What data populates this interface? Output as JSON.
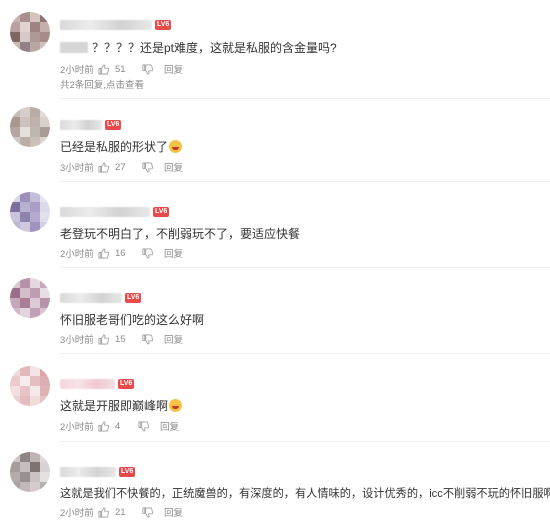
{
  "comments": [
    {
      "text": "？？？？还是pt难度，这就是私服的含金量吗?",
      "time": "2小时前",
      "likes": "51",
      "reply_label": "回复",
      "level": "LV6",
      "more_replies": {
        "count_text": "共2条回复,",
        "view_link": "点击查看"
      },
      "avatar_colors": [
        "#c9b3b0",
        "#a88e8c",
        "#d4c4c1",
        "#8f7673",
        "#b9a19f",
        "#e0d2cf",
        "#9d8381",
        "#c3aeab",
        "#7e6663",
        "#d8c9c6",
        "#b09896",
        "#a58b89",
        "#cdbbb8",
        "#938087",
        "#baa6a3",
        "#d1c1be"
      ]
    },
    {
      "text": "已经是私服的形状了",
      "time": "3小时前",
      "likes": "27",
      "reply_label": "回复",
      "level": "LV6",
      "avatar_colors": [
        "#c7bcb8",
        "#d6ccc9",
        "#b8aca8",
        "#e2dad7",
        "#a8998f",
        "#cdc2be",
        "#bfb2ad",
        "#d9d0cc",
        "#b3a59f",
        "#e6e0dd",
        "#c1b5b0",
        "#a99b95",
        "#d2c8c4",
        "#bcaea8",
        "#cbbfba",
        "#dcd3cf"
      ]
    },
    {
      "text": "老登玩不明白了，不削弱玩不了，要适应快餐",
      "time": "2小时前",
      "likes": "16",
      "reply_label": "回复",
      "level": "LV6",
      "avatar_colors": [
        "#d8d6e6",
        "#9c8fb8",
        "#c4bfd9",
        "#e6e4ef",
        "#7d6f9c",
        "#b8b1d0",
        "#a99fc4",
        "#dcd9e8",
        "#c9c3dc",
        "#8f82ad",
        "#b3abcd",
        "#e1dfec",
        "#bdb6d4",
        "#cfcae0",
        "#a094bf",
        "#d3cfe3"
      ]
    },
    {
      "text": "怀旧服老哥们吃的这么好啊",
      "time": "3小时前",
      "likes": "15",
      "reply_label": "回复",
      "level": "LV6",
      "avatar_colors": [
        "#d9c9d3",
        "#b691a8",
        "#e4d7df",
        "#c9a8bc",
        "#9a6d88",
        "#d3bdc9",
        "#bf9db1",
        "#e8dde4",
        "#c7a7ba",
        "#a97f98",
        "#dccad5",
        "#b892a9",
        "#d1b9c7",
        "#e3d5de",
        "#c2a0b4",
        "#d7c4cf"
      ]
    },
    {
      "text": "这就是开服即巅峰啊",
      "time": "2小时前",
      "likes": "4",
      "reply_label": "回复",
      "level": "LV6",
      "avatar_colors": [
        "#f0d9d9",
        "#e3b8bc",
        "#f4e4e4",
        "#d9a5aa",
        "#ecc9cc",
        "#f7ecec",
        "#e6bec2",
        "#dcadb2",
        "#f2dfdf",
        "#e9c4c7",
        "#f5e8e8",
        "#dfb2b6",
        "#eecfd1",
        "#e4bbbe",
        "#f1dcdc",
        "#e8c1c4"
      ]
    },
    {
      "text": "这就是我们不快餐的，正统魔兽的，有深度的，有人情味的，设计优秀的，icc不削弱不玩的怀旧服啊",
      "time": "2小时前",
      "likes": "21",
      "reply_label": "回复",
      "level": "LV6",
      "avatar_colors": [
        "#cfc8c8",
        "#8f8585",
        "#bdb4b4",
        "#e0dada",
        "#a69c9c",
        "#c6bebe",
        "#7d7373",
        "#d8d2d2",
        "#b3aaaa",
        "#9a9090",
        "#cac3c3",
        "#e5e0e0",
        "#aca2a2",
        "#c1b9b9",
        "#d4cdcd",
        "#b8afaf"
      ]
    }
  ]
}
